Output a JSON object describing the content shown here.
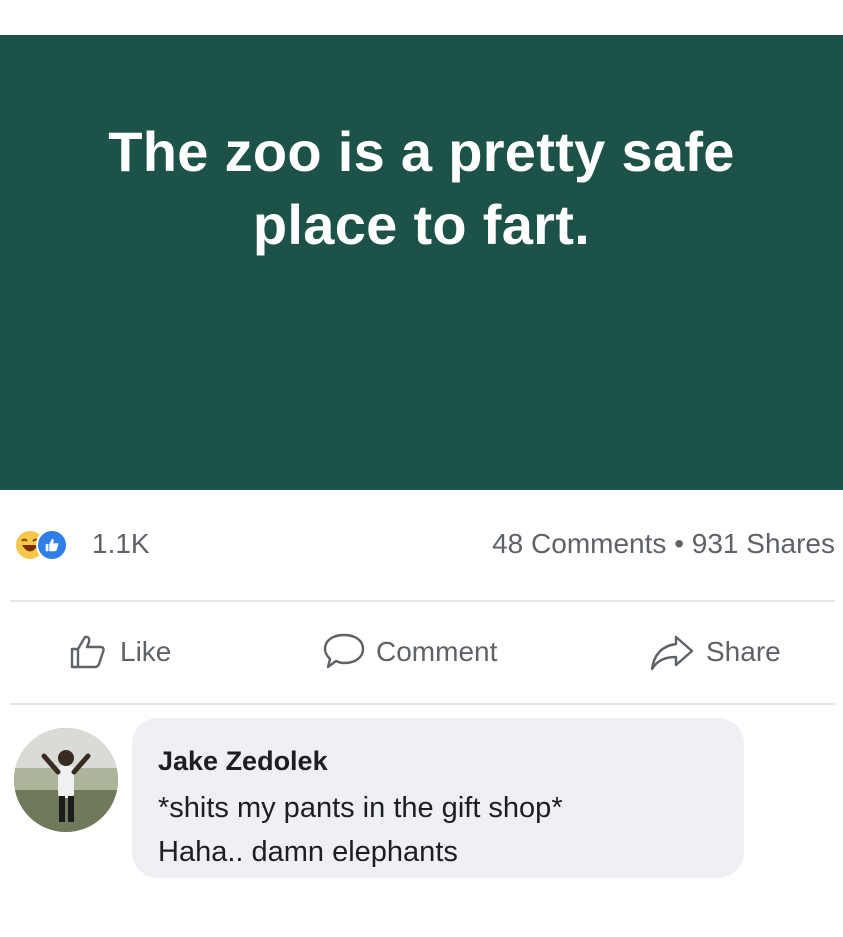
{
  "post": {
    "text": "The zoo is a pretty safe place to fart."
  },
  "stats": {
    "reaction_count": "1.1K",
    "comments": "48 Comments",
    "separator": "•",
    "shares": "931 Shares",
    "reaction_icons": [
      "haha-reaction-icon",
      "like-reaction-icon"
    ]
  },
  "actions": {
    "like_label": "Like",
    "comment_label": "Comment",
    "share_label": "Share"
  },
  "comment": {
    "author": "Jake Zedolek",
    "line1": "*shits my pants in the gift shop*",
    "line2": "Haha.. damn elephants"
  },
  "colors": {
    "post_background": "#1c5248",
    "text_muted": "#5f6368",
    "comment_bubble": "#eef0f3",
    "like_blue": "#2f7fe8",
    "haha_yellow": "#f7c74a"
  }
}
